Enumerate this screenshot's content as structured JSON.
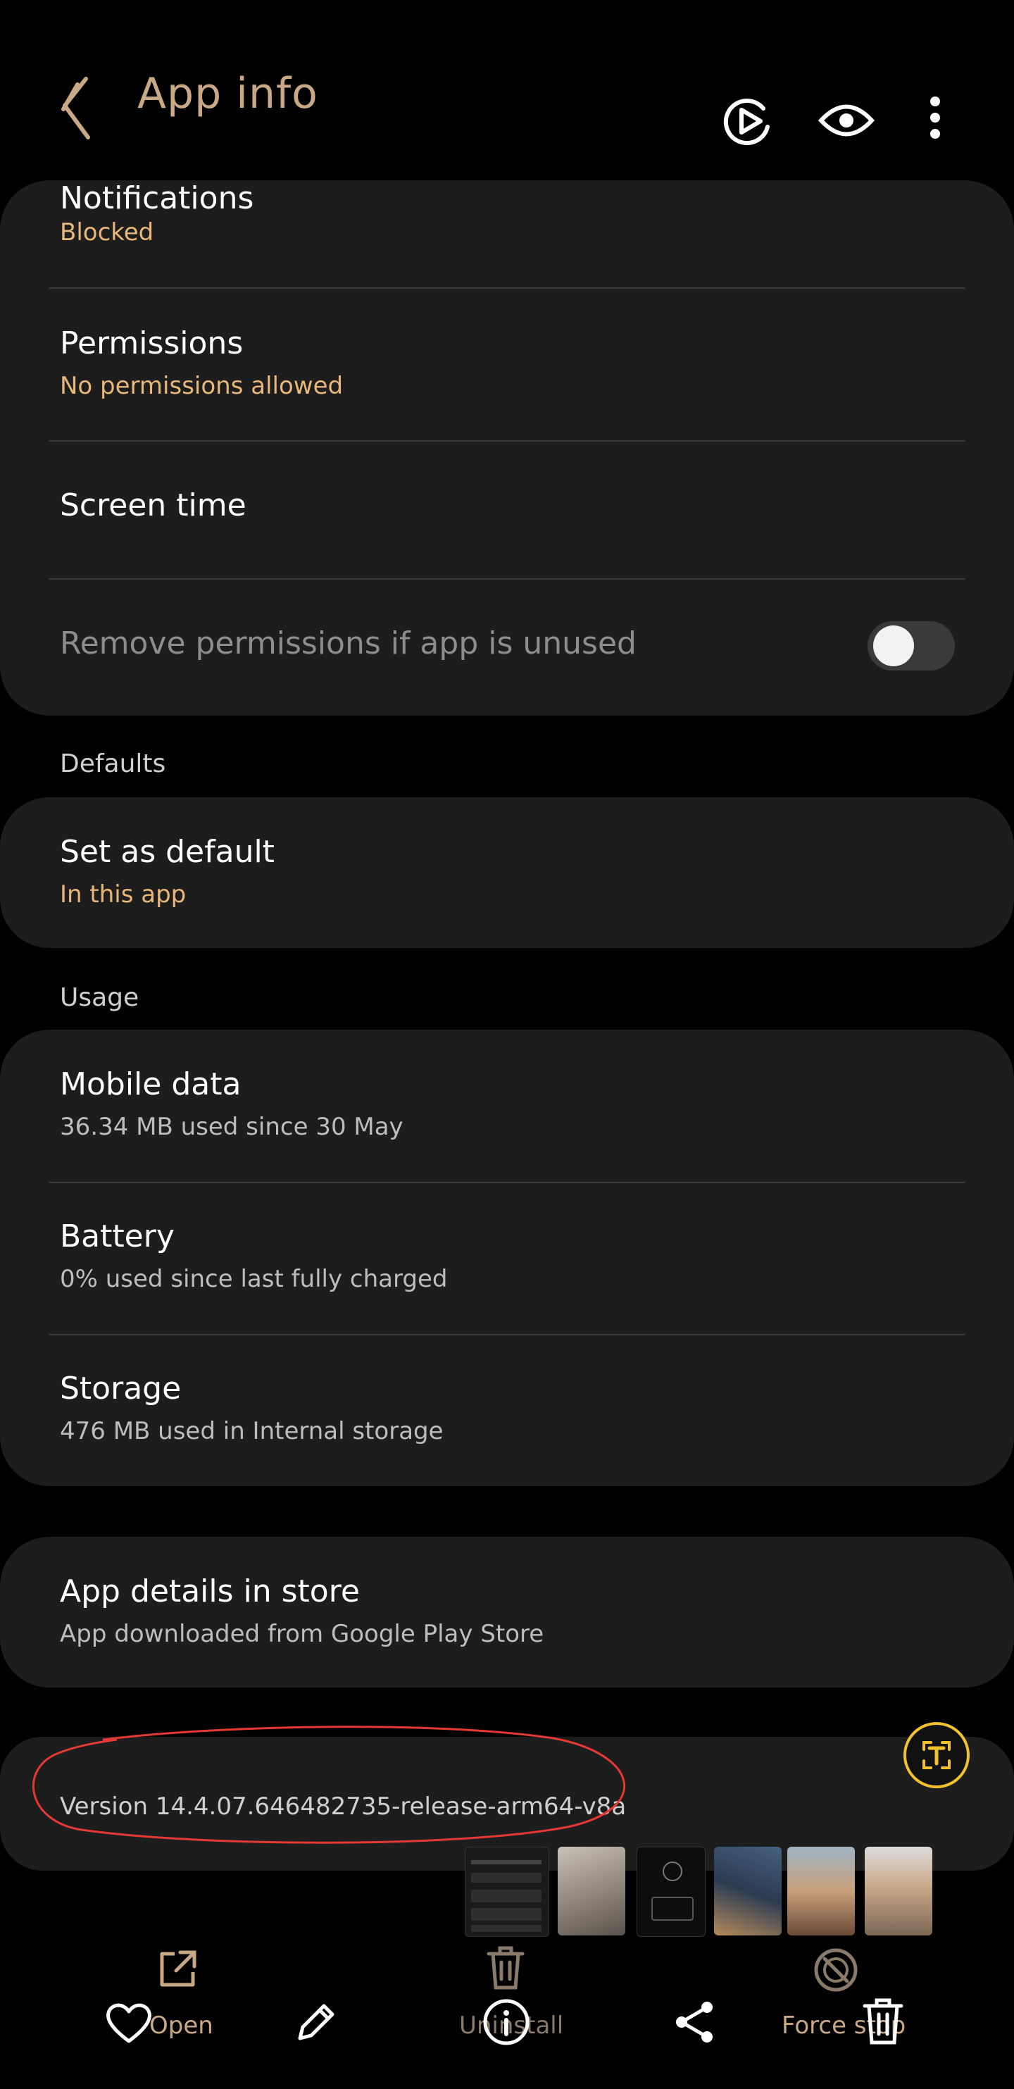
{
  "header": {
    "title": "App info",
    "back_icon": "chevron-left-icon",
    "actions": [
      "screen-record-icon",
      "eye-icon",
      "more-vert-icon"
    ]
  },
  "app_settings": {
    "notifications": {
      "title": "Notifications",
      "subtitle": "Blocked"
    },
    "permissions": {
      "title": "Permissions",
      "subtitle": "No permissions allowed"
    },
    "screen_time": {
      "title": "Screen time"
    },
    "remove_permissions": {
      "title": "Remove permissions if app is unused",
      "toggle": "off"
    }
  },
  "defaults": {
    "section_title": "Defaults",
    "set_as_default": {
      "title": "Set as default",
      "subtitle": "In this app"
    }
  },
  "usage": {
    "section_title": "Usage",
    "mobile_data": {
      "title": "Mobile data",
      "subtitle": "36.34 MB used since 30 May"
    },
    "battery": {
      "title": "Battery",
      "subtitle": "0% used since last fully charged"
    },
    "storage": {
      "title": "Storage",
      "subtitle": "476 MB used in Internal storage"
    }
  },
  "store": {
    "title": "App details in store",
    "subtitle": "App downloaded from Google Play Store"
  },
  "version": {
    "text": "Version 14.4.07.646482735-release-arm64-v8a"
  },
  "bottom_actions": {
    "open": "Open",
    "uninstall": "Uninstall",
    "force_stop": "Force stop"
  },
  "screenshot_toolbar": {
    "icons": [
      "heart-icon",
      "pencil-icon",
      "info-icon",
      "share-icon",
      "trash-icon"
    ]
  },
  "colors": {
    "background": "#000000",
    "card": "#1d1d1d",
    "accent": "#e9b77a",
    "title_accent": "#c9a886",
    "annotation": "#e53935",
    "scan_text": "#f2c12e"
  }
}
